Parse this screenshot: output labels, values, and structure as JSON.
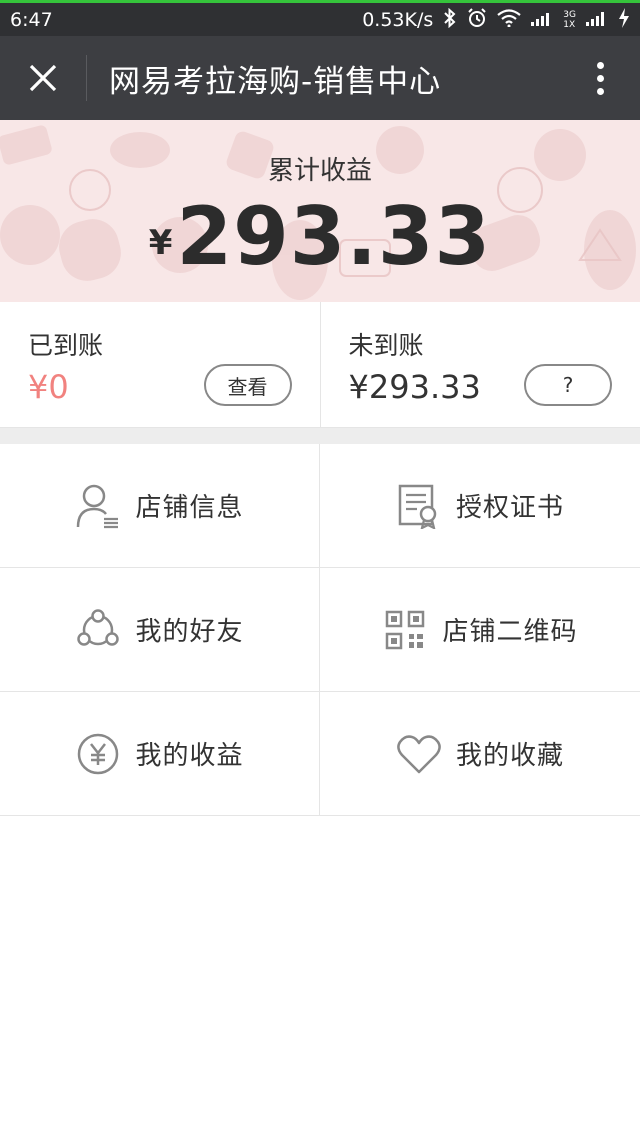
{
  "status": {
    "time": "6:47",
    "net_speed": "0.53K/s",
    "net_type_top": "3G",
    "net_type_bottom": "1X"
  },
  "header": {
    "title": "网易考拉海购-销售中心"
  },
  "hero": {
    "label": "累计收益",
    "currency": "¥",
    "amount": "293.33"
  },
  "balance": {
    "received_label": "已到账",
    "received_value": "¥0",
    "view_button": "查看",
    "pending_label": "未到账",
    "pending_value": "¥293.33",
    "help_button": "?"
  },
  "menu": [
    {
      "label": "店铺信息",
      "icon": "user-info-icon"
    },
    {
      "label": "授权证书",
      "icon": "certificate-icon"
    },
    {
      "label": "我的好友",
      "icon": "friends-network-icon"
    },
    {
      "label": "店铺二维码",
      "icon": "qr-code-icon"
    },
    {
      "label": "我的收益",
      "icon": "yen-circle-icon"
    },
    {
      "label": "我的收藏",
      "icon": "heart-icon"
    }
  ],
  "colors": {
    "status_bar": "#2f3033",
    "title_bar": "#3d3e42",
    "accent_red": "#f1827f",
    "hero_bg": "#f8e7e7"
  }
}
